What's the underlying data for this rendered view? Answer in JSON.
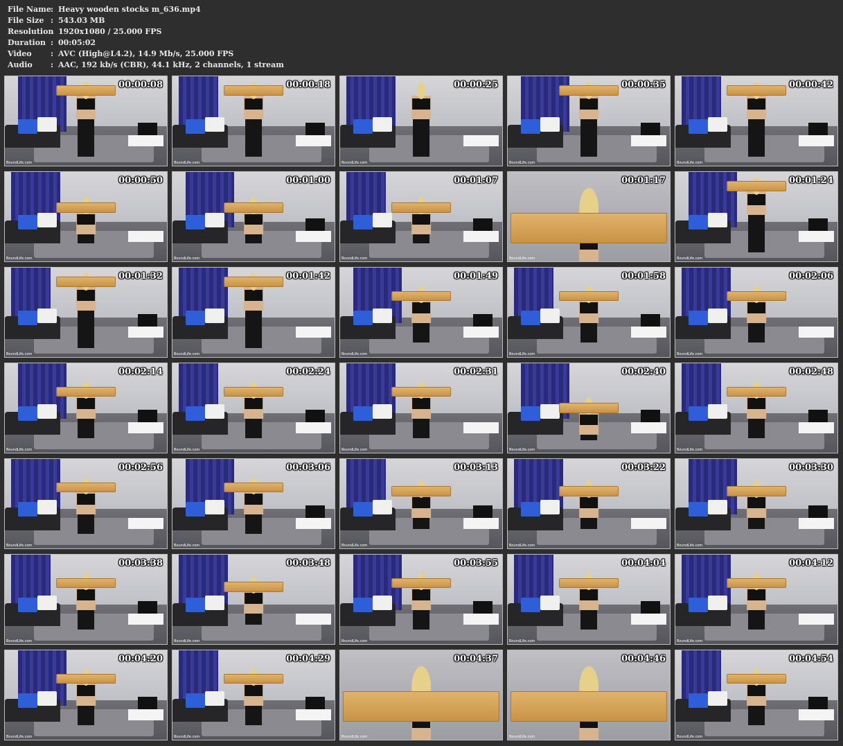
{
  "info": {
    "rows": [
      {
        "label": "File Name",
        "sep": ":",
        "value": "Heavy wooden stocks m_636.mp4"
      },
      {
        "label": "File Size",
        "sep": ":",
        "value": "543.03 MB"
      },
      {
        "label": "Resolution",
        "sep": ":",
        "value": "1920x1080 / 25.000 FPS"
      },
      {
        "label": "Duration",
        "sep": ":",
        "value": "00:05:02"
      },
      {
        "label": "Video",
        "sep": ":",
        "value": "AVC (High@L4.2), 14.9 Mb/s, 25.000 FPS"
      },
      {
        "label": "Audio",
        "sep": ":",
        "value": "AAC, 192 kb/s (CBR), 44.1 kHz, 2 channels, 1 stream"
      }
    ]
  },
  "thumbnails": [
    {
      "time": "00:00:08",
      "watermark": "BoundLife.com",
      "pose": "standing-front"
    },
    {
      "time": "00:00:18",
      "watermark": "BoundLife.com",
      "pose": "standing-back"
    },
    {
      "time": "00:00:25",
      "watermark": "BoundLife.com",
      "pose": "standing-side"
    },
    {
      "time": "00:00:35",
      "watermark": "BoundLife.com",
      "pose": "standing-front"
    },
    {
      "time": "00:00:42",
      "watermark": "BoundLife.com",
      "pose": "standing-front"
    },
    {
      "time": "00:00:50",
      "watermark": "BoundLife.com",
      "pose": "sitting"
    },
    {
      "time": "00:01:00",
      "watermark": "BoundLife.com",
      "pose": "sitting"
    },
    {
      "time": "00:01:07",
      "watermark": "BoundLife.com",
      "pose": "sitting"
    },
    {
      "time": "00:01:17",
      "watermark": "BoundLife.com",
      "pose": "closeup"
    },
    {
      "time": "00:01:24",
      "watermark": "BoundLife.com",
      "pose": "standing-front"
    },
    {
      "time": "00:01:32",
      "watermark": "BoundLife.com",
      "pose": "standing-front"
    },
    {
      "time": "00:01:42",
      "watermark": "BoundLife.com",
      "pose": "standing-front"
    },
    {
      "time": "00:01:49",
      "watermark": "BoundLife.com",
      "pose": "kneeling"
    },
    {
      "time": "00:01:58",
      "watermark": "BoundLife.com",
      "pose": "kneeling"
    },
    {
      "time": "00:02:06",
      "watermark": "BoundLife.com",
      "pose": "kneeling"
    },
    {
      "time": "00:02:14",
      "watermark": "BoundLife.com",
      "pose": "kneeling"
    },
    {
      "time": "00:02:24",
      "watermark": "BoundLife.com",
      "pose": "kneeling"
    },
    {
      "time": "00:02:31",
      "watermark": "BoundLife.com",
      "pose": "kneeling"
    },
    {
      "time": "00:02:40",
      "watermark": "BoundLife.com",
      "pose": "bent"
    },
    {
      "time": "00:02:48",
      "watermark": "BoundLife.com",
      "pose": "kneeling"
    },
    {
      "time": "00:02:56",
      "watermark": "BoundLife.com",
      "pose": "kneeling"
    },
    {
      "time": "00:03:06",
      "watermark": "BoundLife.com",
      "pose": "kneeling"
    },
    {
      "time": "00:03:13",
      "watermark": "BoundLife.com",
      "pose": "floor"
    },
    {
      "time": "00:03:22",
      "watermark": "BoundLife.com",
      "pose": "floor"
    },
    {
      "time": "00:03:30",
      "watermark": "BoundLife.com",
      "pose": "floor"
    },
    {
      "time": "00:03:38",
      "watermark": "BoundLife.com",
      "pose": "kneeling"
    },
    {
      "time": "00:03:48",
      "watermark": "BoundLife.com",
      "pose": "floor"
    },
    {
      "time": "00:03:55",
      "watermark": "BoundLife.com",
      "pose": "kneeling"
    },
    {
      "time": "00:04:04",
      "watermark": "BoundLife.com",
      "pose": "kneeling"
    },
    {
      "time": "00:04:12",
      "watermark": "BoundLife.com",
      "pose": "kneeling"
    },
    {
      "time": "00:04:20",
      "watermark": "BoundLife.com",
      "pose": "kneeling"
    },
    {
      "time": "00:04:29",
      "watermark": "BoundLife.com",
      "pose": "kneeling"
    },
    {
      "time": "00:04:37",
      "watermark": "BoundLife.com",
      "pose": "closeup"
    },
    {
      "time": "00:04:46",
      "watermark": "BoundLife.com",
      "pose": "closeup"
    },
    {
      "time": "00:04:54",
      "watermark": "BoundLife.com",
      "pose": "kneeling"
    }
  ],
  "colors": {
    "background": "#2e2e2e",
    "text": "#e8e8e8",
    "timestamp": "#ffffff",
    "stocks_wood": "#d9a75a",
    "curtain": "#2f2f8a"
  }
}
